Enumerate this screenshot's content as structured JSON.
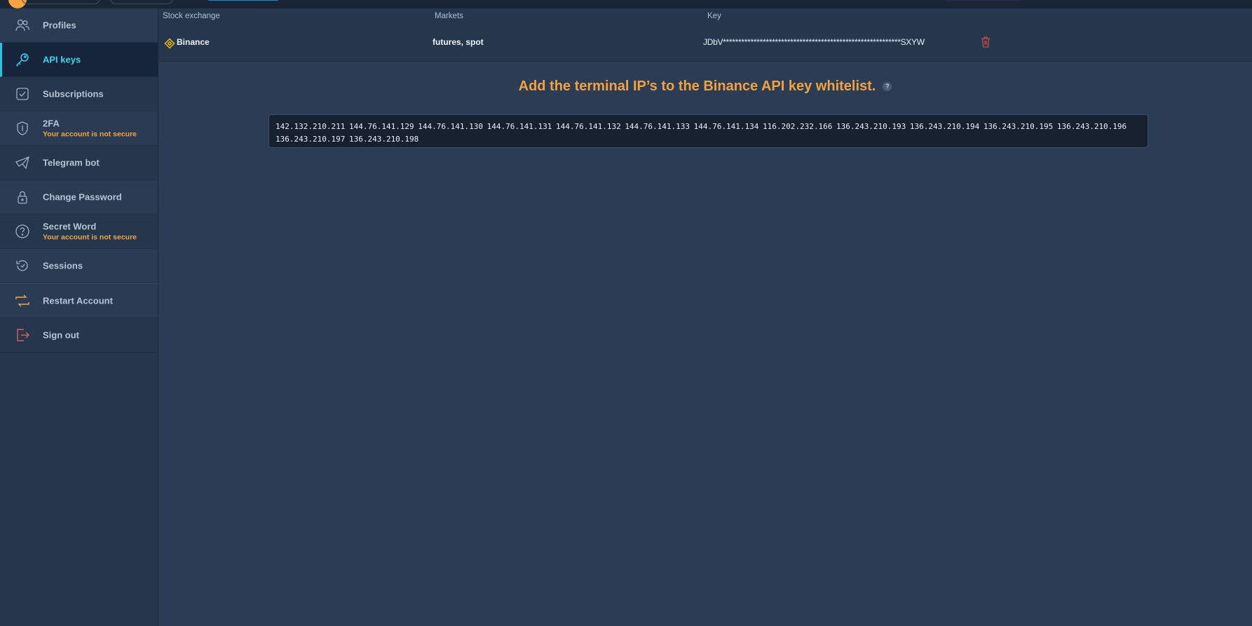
{
  "sidebar": {
    "items": [
      {
        "label": "Profiles",
        "warning": ""
      },
      {
        "label": "API keys",
        "warning": ""
      },
      {
        "label": "Subscriptions",
        "warning": ""
      },
      {
        "label": "2FA",
        "warning": "Your account is not secure"
      },
      {
        "label": "Telegram bot",
        "warning": ""
      },
      {
        "label": "Change Password",
        "warning": ""
      },
      {
        "label": "Secret Word",
        "warning": "Your account is not secure"
      },
      {
        "label": "Sessions",
        "warning": ""
      },
      {
        "label": "Restart Account",
        "warning": ""
      },
      {
        "label": "Sign out",
        "warning": ""
      }
    ],
    "active": "API keys"
  },
  "table": {
    "headers": {
      "exchange": "Stock exchange",
      "markets": "Markets",
      "key": "Key"
    },
    "rows": [
      {
        "exchange": "Binance",
        "markets": "futures, spot",
        "key": "JDbV**********************************************************SXYW"
      }
    ]
  },
  "notice": {
    "text": "Add the terminal IP’s to the Binance API key whitelist.",
    "help": "?"
  },
  "ip_list": "142.132.210.211 144.76.141.129 144.76.141.130 144.76.141.131 144.76.141.132 144.76.141.133 144.76.141.134 116.202.232.166 136.243.210.193 136.243.210.194 136.243.210.195 136.243.210.196 136.243.210.197 136.243.210.198",
  "colors": {
    "accent": "#27c3e0",
    "warning": "#f5a33c",
    "binance": "#f0b90b",
    "danger": "#c84b4b"
  }
}
